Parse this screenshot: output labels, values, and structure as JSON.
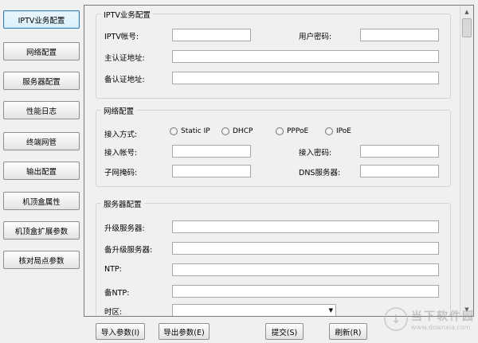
{
  "nav": {
    "items": [
      {
        "label": "IPTV业务配置",
        "active": true
      },
      {
        "label": "网络配置"
      },
      {
        "label": "服务器配置"
      },
      {
        "label": "性能日志"
      },
      {
        "label": "终端网管"
      },
      {
        "label": "输出配置"
      },
      {
        "label": "机顶盒属性"
      },
      {
        "label": "机顶盒扩展参数"
      },
      {
        "label": "核对局点参数"
      }
    ]
  },
  "iptv": {
    "title": "IPTV业务配置",
    "account_label": "IPTV帐号:",
    "account_value": "",
    "password_label": "用户密码:",
    "password_value": "",
    "main_auth_label": "主认证地址:",
    "main_auth_value": "",
    "backup_auth_label": "备认证地址:",
    "backup_auth_value": ""
  },
  "network": {
    "title": "网络配置",
    "access_mode_label": "接入方式:",
    "modes": [
      "Static IP",
      "DHCP",
      "PPPoE",
      "IPoE"
    ],
    "access_account_label": "接入帐号:",
    "access_account_value": "",
    "access_password_label": "接入密码:",
    "access_password_value": "",
    "subnet_label": "子网掩码:",
    "subnet_value": "",
    "dns_label": "DNS服务器:",
    "dns_value": ""
  },
  "server": {
    "title": "服务器配置",
    "upgrade_label": "升级服务器:",
    "upgrade_value": "",
    "backup_upgrade_label": "备升级服务器:",
    "backup_upgrade_value": "",
    "ntp_label": "NTP:",
    "ntp_value": "",
    "backup_ntp_label": "备NTP:",
    "backup_ntp_value": "",
    "timezone_label": "时区:",
    "timezone_value": ""
  },
  "actions": {
    "import": "导入参数(I)",
    "export": "导出参数(E)",
    "submit": "提交(S)",
    "refresh": "刷新(R)"
  },
  "watermark": {
    "name": "当下软件园",
    "url": "www.downxia.com"
  }
}
